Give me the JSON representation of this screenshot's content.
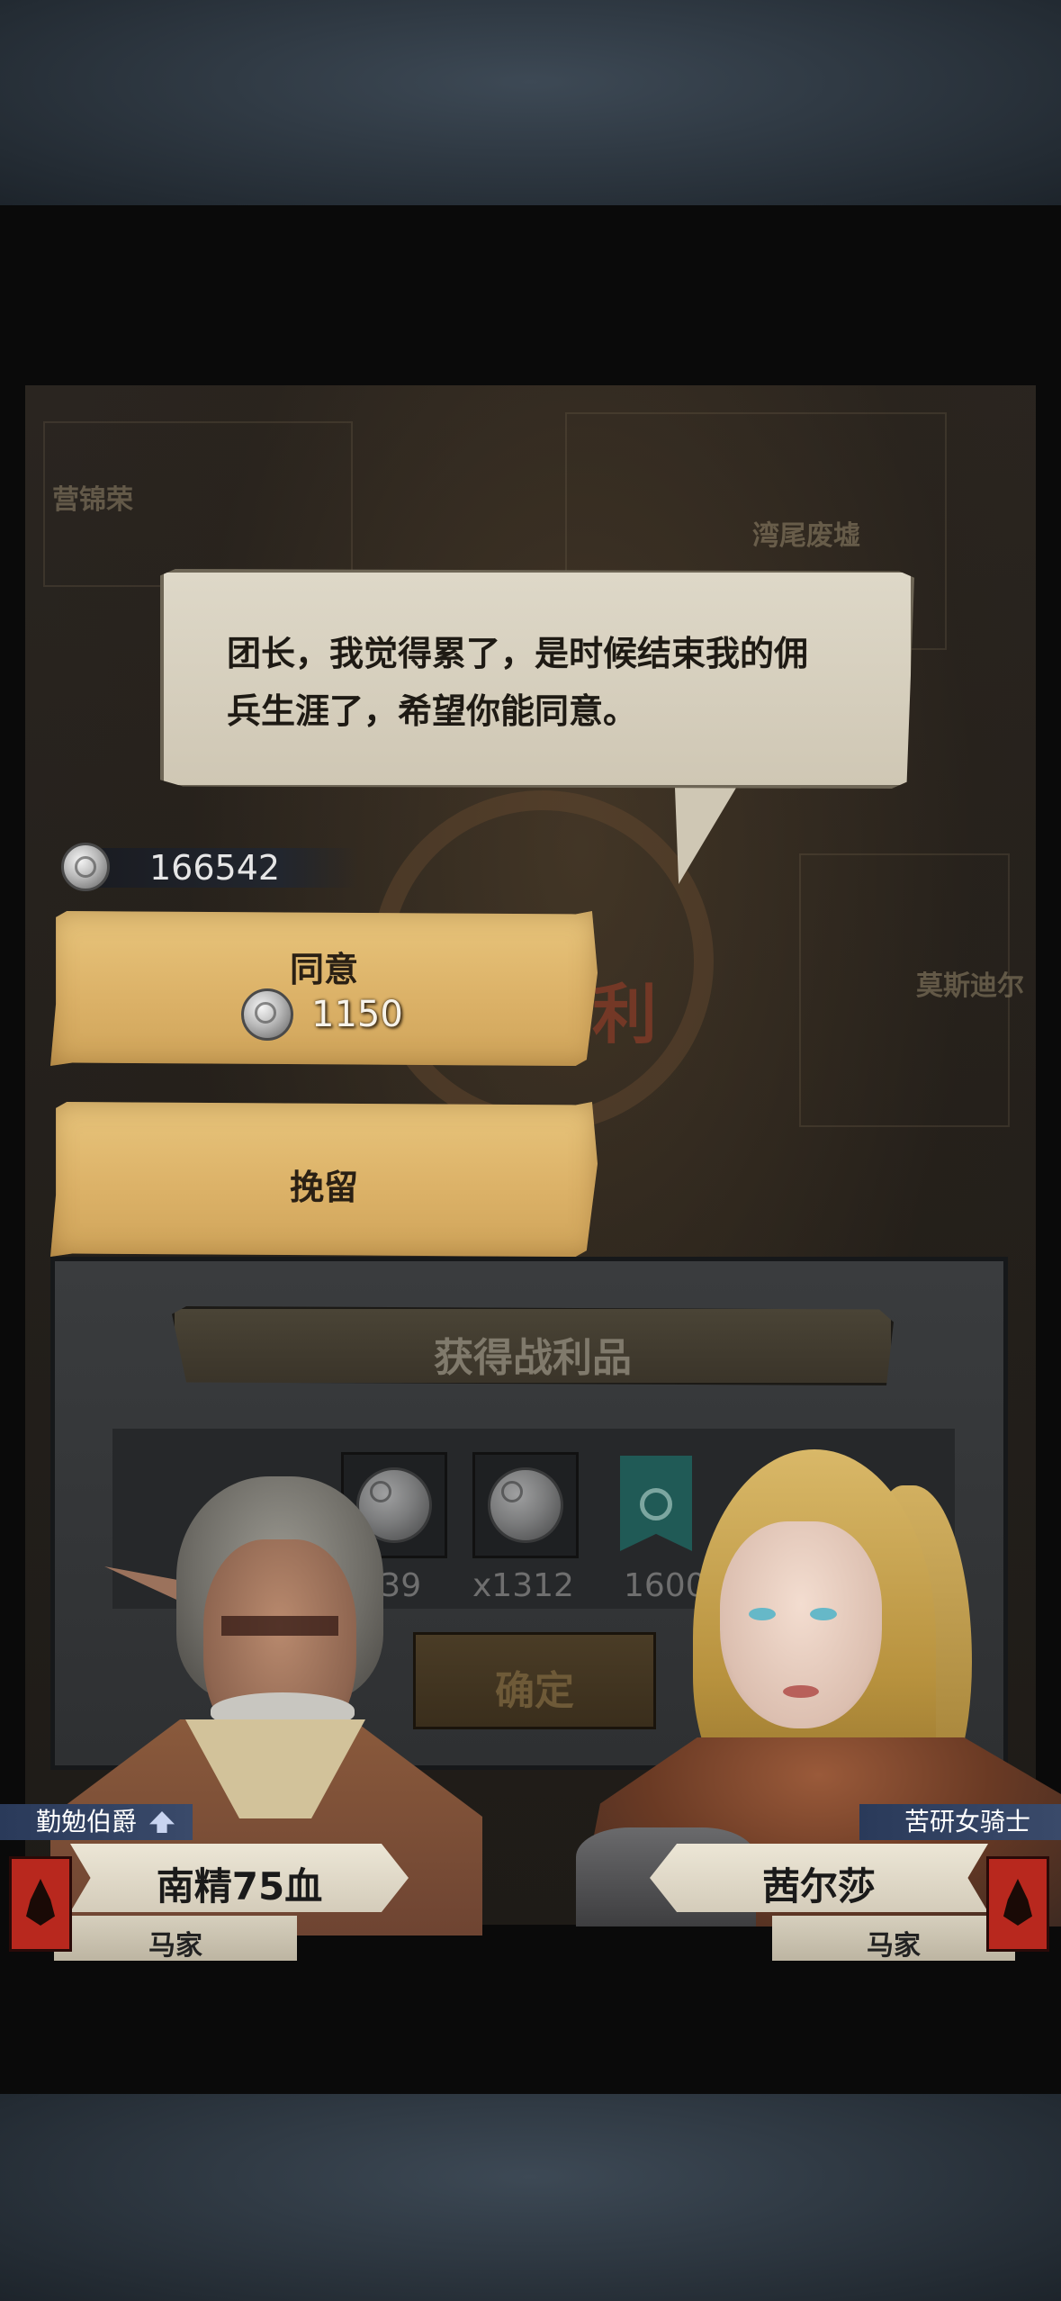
{
  "dialog": {
    "line1": "团长，我觉得累了，是时候结束我的佣",
    "line2": "兵生涯了，希望你能同意。"
  },
  "currency": {
    "icon": "silver-coin-icon",
    "amount": "166542"
  },
  "buttons": {
    "agree_label": "同意",
    "agree_cost": "1150",
    "keep_label": "挽留"
  },
  "background_map": {
    "labels": [
      "营锦荣",
      "湾尾废墟",
      "莫斯迪尔"
    ],
    "emblem_char": "利"
  },
  "loot": {
    "title": "获得战利品",
    "items": [
      {
        "icon": "silver-coin-icon",
        "count": "x39"
      },
      {
        "icon": "silver-coin-icon",
        "count": "x1312"
      },
      {
        "icon": "banner-icon",
        "count": "1600"
      }
    ],
    "confirm_label": "确定"
  },
  "characters": {
    "left": {
      "title": "勤勉伯爵",
      "name": "南精75血",
      "faction": "马家"
    },
    "right": {
      "title": "苦研女骑士",
      "name": "茜尔莎",
      "faction": "马家"
    }
  },
  "colors": {
    "parchment_button": "#dcb268",
    "bubble": "#d8d1bf",
    "title_tag": "#2a3a5a",
    "faction_banner": "#b8281e"
  }
}
